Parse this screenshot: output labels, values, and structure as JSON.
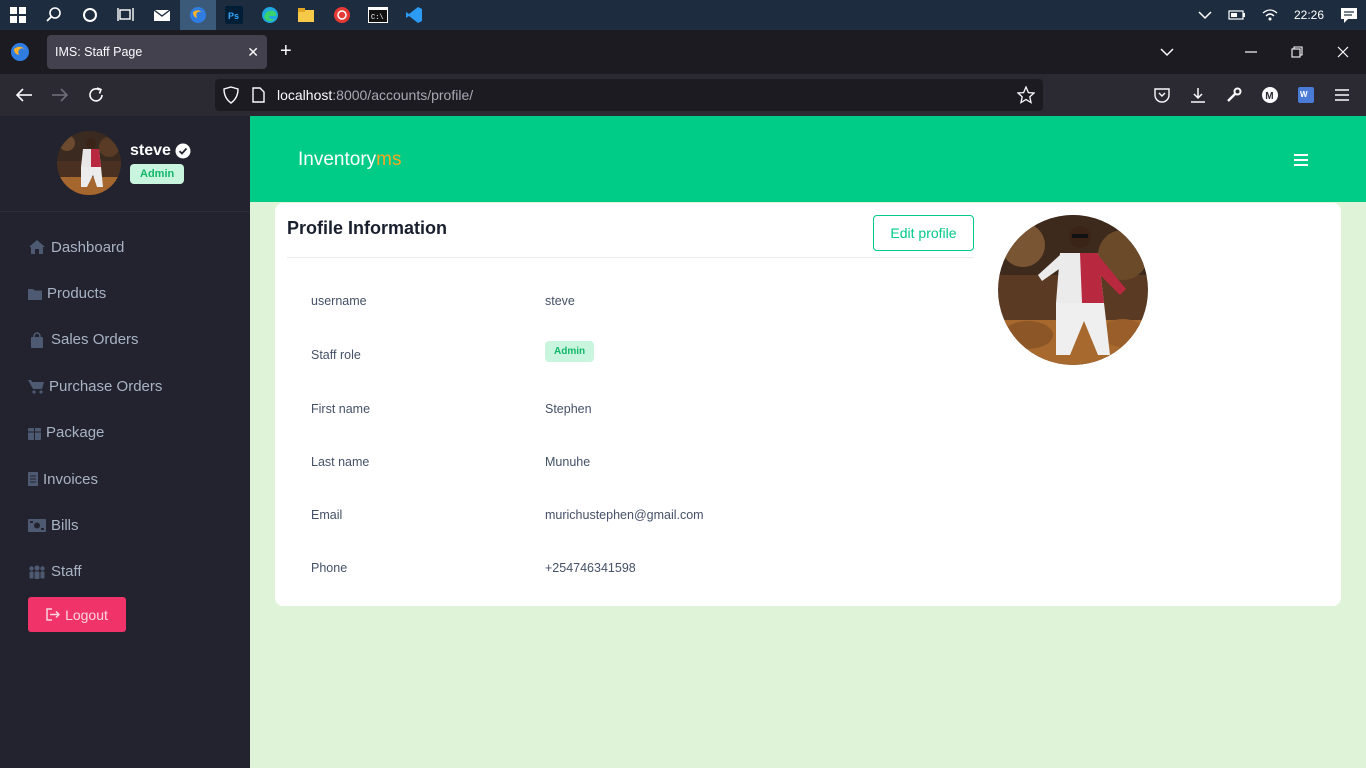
{
  "os": {
    "clock": "22:26"
  },
  "browser": {
    "tab_title": "IMS: Staff Page",
    "url_host": "localhost",
    "url_rest": ":8000/accounts/profile/"
  },
  "sidebar": {
    "user_name": "steve",
    "user_role": "Admin",
    "items": [
      {
        "label": "Dashboard",
        "icon": "home-icon"
      },
      {
        "label": "Products",
        "icon": "folder-icon"
      },
      {
        "label": "Sales Orders",
        "icon": "bag-icon"
      },
      {
        "label": "Purchase Orders",
        "icon": "cart-icon"
      },
      {
        "label": "Package",
        "icon": "box-icon"
      },
      {
        "label": "Invoices",
        "icon": "invoice-icon"
      },
      {
        "label": "Bills",
        "icon": "money-icon"
      },
      {
        "label": "Staff",
        "icon": "users-icon"
      }
    ],
    "logout_label": "Logout"
  },
  "header": {
    "brand_main": "Inventory",
    "brand_accent": "ms"
  },
  "profile": {
    "title": "Profile Information",
    "edit_label": "Edit profile",
    "fields": [
      {
        "label": "username",
        "value": "steve"
      },
      {
        "label": "Staff role",
        "value": "Admin"
      },
      {
        "label": "First name",
        "value": "Stephen"
      },
      {
        "label": "Last name",
        "value": "Munuhe"
      },
      {
        "label": "Email",
        "value": "murichustephen@gmail.com"
      },
      {
        "label": "Phone",
        "value": "+254746341598"
      }
    ]
  },
  "colors": {
    "accent": "#00cc88",
    "sidebar": "#23232f",
    "danger": "#f0346a",
    "brand_accent": "#f5a623"
  }
}
